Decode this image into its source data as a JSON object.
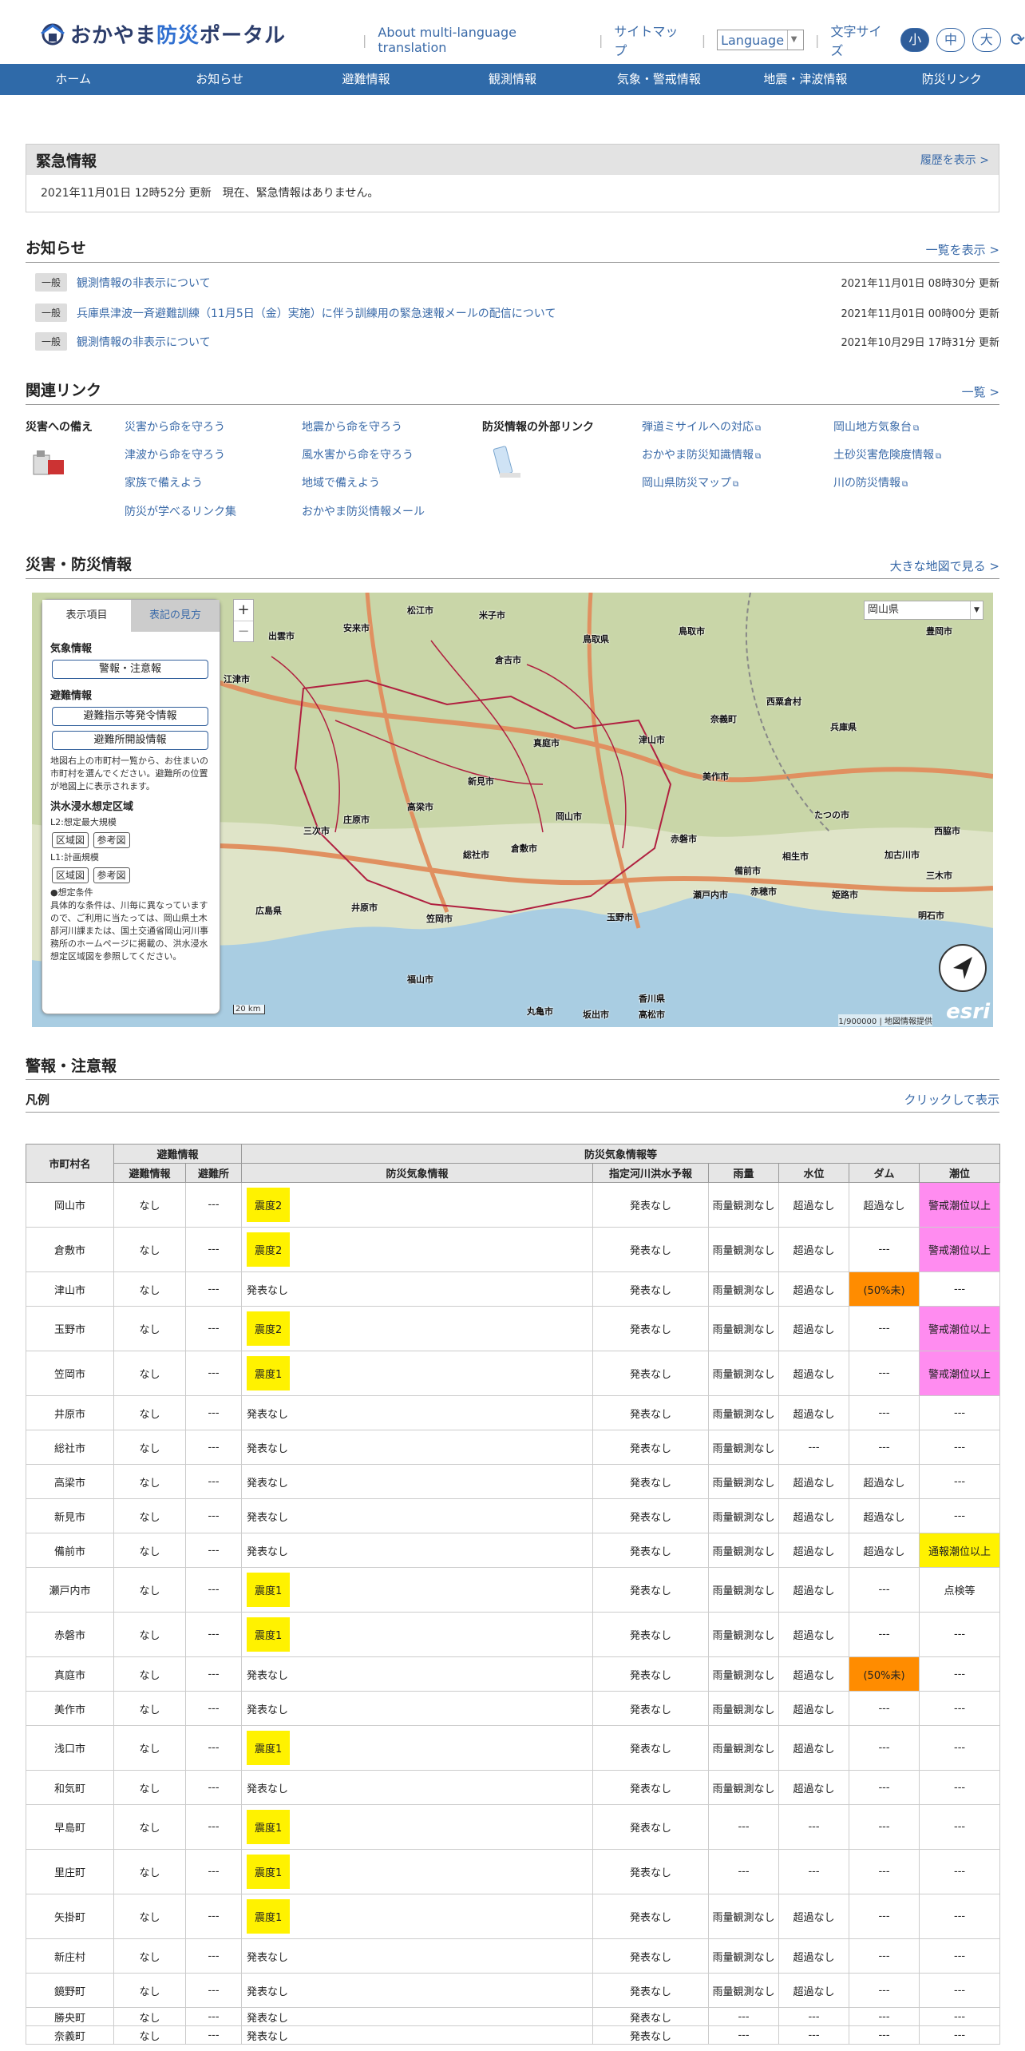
{
  "header": {
    "logo_a": "おかやま",
    "logo_b": "防災",
    "logo_c": "ポータル",
    "links": [
      "About multi-language translation",
      "サイトマップ"
    ],
    "language": "Language",
    "font_size_label": "文字サイズ",
    "font_sizes": [
      "小",
      "中",
      "大"
    ]
  },
  "nav": [
    "ホーム",
    "お知らせ",
    "避難情報",
    "観測情報",
    "気象・警戒情報",
    "地震・津波情報",
    "防災リンク"
  ],
  "emergency": {
    "title": "緊急情報",
    "history_link": "履歴を表示 >",
    "message": "2021年11月01日 12時52分 更新　現在、緊急情報はありません。"
  },
  "notices": {
    "title": "お知らせ",
    "more": "一覧を表示 >",
    "items": [
      {
        "tag": "一般",
        "text": "観測情報の非表示について",
        "date": "2021年11月01日 08時30分 更新"
      },
      {
        "tag": "一般",
        "text": "兵庫県津波一斉避難訓練（11月5日（金）実施）に伴う訓練用の緊急速報メールの配信について",
        "date": "2021年11月01日 00時00分 更新"
      },
      {
        "tag": "一般",
        "text": "観測情報の非表示について",
        "date": "2021年10月29日 17時31分 更新"
      }
    ]
  },
  "related": {
    "title": "関連リンク",
    "more": "一覧 >",
    "group1": "災害への備え",
    "group2": "防災情報の外部リンク",
    "links1": [
      "災害から命を守ろう",
      "地震から命を守ろう",
      "津波から命を守ろう",
      "風水害から命を守ろう",
      "家族で備えよう",
      "地域で備えよう",
      "防災が学べるリンク集",
      "おかやま防災情報メール"
    ],
    "links2": [
      "弾道ミサイルへの対応",
      "岡山地方気象台",
      "おかやま防災知識情報",
      "土砂災害危険度情報",
      "岡山県防災マップ",
      "川の防災情報"
    ]
  },
  "map": {
    "title": "災害・防災情報",
    "more": "大きな地図で見る >",
    "tab_on": "表示項目",
    "tab_off": "表記の見方",
    "weather_label": "気象情報",
    "weather_btn": "警報・注意報",
    "evac_label": "避難情報",
    "evac_btn1": "避難指示等発令情報",
    "evac_btn2": "避難所開設情報",
    "evac_note": "地図右上の市町村一覧から、お住まいの市町村を選んでください。避難所の位置が地図上に表示されます。",
    "flood_label": "洪水浸水想定区域",
    "l2": "L2:想定最大規模",
    "l1": "L1:計画規模",
    "btn_area": "区域図",
    "btn_ref": "参考図",
    "cond_title": "●想定条件",
    "cond_text": "具体的な条件は、川毎に異なっていますので、ご利用に当たっては、岡山県土木部河川課または、国土交通省岡山河川事務所のホームページに掲載の、洪水浸水想定区域図を参照してください。",
    "select": "岡山県",
    "scale": "20 km",
    "attribution": "1/900000 | 地図情報提供",
    "esri": "esri",
    "places": [
      "鳥取県",
      "兵庫県",
      "岡山市",
      "倉敷市",
      "津山市",
      "広島県",
      "新見市",
      "真庭市",
      "高梁市",
      "赤磐市",
      "美作市",
      "備前市",
      "総社市",
      "笠岡市",
      "井原市",
      "玉野市",
      "瀬戸内市",
      "香川県",
      "姫路市",
      "加古川市",
      "たつの市",
      "相生市",
      "赤穂市",
      "倉吉市",
      "鳥取市",
      "出雲市",
      "米子市",
      "庄原市",
      "三次市",
      "福山市",
      "豊岡市",
      "西脇市",
      "三木市",
      "明石市",
      "高松市",
      "坂出市",
      "丸亀市",
      "江津市",
      "安来市",
      "松江市",
      "奈義町",
      "西粟倉村"
    ]
  },
  "warnings": {
    "title": "警報・注意報",
    "legend": "凡例",
    "legend_link": "クリックして表示",
    "header_group1": "避難情報",
    "header_group2": "防災気象情報等",
    "cols": [
      "市町村名",
      "避難情報",
      "避難所",
      "防災気象情報",
      "指定河川洪水予報",
      "雨量",
      "水位",
      "ダム",
      "潮位"
    ],
    "rows": [
      [
        "岡山市",
        "なし",
        "---",
        "震度2",
        "発表なし",
        "雨量観測なし",
        "超過なし",
        "超過なし",
        "警戒潮位以上"
      ],
      [
        "倉敷市",
        "なし",
        "---",
        "震度2",
        "発表なし",
        "雨量観測なし",
        "超過なし",
        "---",
        "警戒潮位以上"
      ],
      [
        "津山市",
        "なし",
        "---",
        "発表なし",
        "発表なし",
        "雨量観測なし",
        "超過なし",
        "(50%未)",
        "---"
      ],
      [
        "玉野市",
        "なし",
        "---",
        "震度2",
        "発表なし",
        "雨量観測なし",
        "超過なし",
        "---",
        "警戒潮位以上"
      ],
      [
        "笠岡市",
        "なし",
        "---",
        "震度1",
        "発表なし",
        "雨量観測なし",
        "超過なし",
        "---",
        "警戒潮位以上"
      ],
      [
        "井原市",
        "なし",
        "---",
        "発表なし",
        "発表なし",
        "雨量観測なし",
        "超過なし",
        "---",
        "---"
      ],
      [
        "総社市",
        "なし",
        "---",
        "発表なし",
        "発表なし",
        "雨量観測なし",
        "---",
        "---",
        "---"
      ],
      [
        "高梁市",
        "なし",
        "---",
        "発表なし",
        "発表なし",
        "雨量観測なし",
        "超過なし",
        "超過なし",
        "---"
      ],
      [
        "新見市",
        "なし",
        "---",
        "発表なし",
        "発表なし",
        "雨量観測なし",
        "超過なし",
        "超過なし",
        "---"
      ],
      [
        "備前市",
        "なし",
        "---",
        "発表なし",
        "発表なし",
        "雨量観測なし",
        "超過なし",
        "超過なし",
        "通報潮位以上"
      ],
      [
        "瀬戸内市",
        "なし",
        "---",
        "震度1",
        "発表なし",
        "雨量観測なし",
        "超過なし",
        "---",
        "点検等"
      ],
      [
        "赤磐市",
        "なし",
        "---",
        "震度1",
        "発表なし",
        "雨量観測なし",
        "超過なし",
        "---",
        "---"
      ],
      [
        "真庭市",
        "なし",
        "---",
        "発表なし",
        "発表なし",
        "雨量観測なし",
        "超過なし",
        "(50%未)",
        "---"
      ],
      [
        "美作市",
        "なし",
        "---",
        "発表なし",
        "発表なし",
        "雨量観測なし",
        "超過なし",
        "---",
        "---"
      ],
      [
        "浅口市",
        "なし",
        "---",
        "震度1",
        "発表なし",
        "雨量観測なし",
        "超過なし",
        "---",
        "---"
      ],
      [
        "和気町",
        "なし",
        "---",
        "発表なし",
        "発表なし",
        "雨量観測なし",
        "超過なし",
        "---",
        "---"
      ],
      [
        "早島町",
        "なし",
        "---",
        "震度1",
        "発表なし",
        "---",
        "---",
        "---",
        "---"
      ],
      [
        "里庄町",
        "なし",
        "---",
        "震度1",
        "発表なし",
        "---",
        "---",
        "---",
        "---"
      ],
      [
        "矢掛町",
        "なし",
        "---",
        "震度1",
        "発表なし",
        "雨量観測なし",
        "超過なし",
        "---",
        "---"
      ],
      [
        "新庄村",
        "なし",
        "---",
        "発表なし",
        "発表なし",
        "雨量観測なし",
        "超過なし",
        "---",
        "---"
      ],
      [
        "鏡野町",
        "なし",
        "---",
        "発表なし",
        "発表なし",
        "雨量観測なし",
        "超過なし",
        "---",
        "---"
      ],
      [
        "勝央町",
        "なし",
        "---",
        "発表なし",
        "発表なし",
        "---",
        "---",
        "---",
        "---"
      ],
      [
        "奈義町",
        "なし",
        "---",
        "発表なし",
        "発表なし",
        "---",
        "---",
        "---",
        "---"
      ]
    ]
  },
  "colors": {
    "nav": "#2f6aa9",
    "badge_yellow": "#fff200",
    "orange": "#ff8c00",
    "pink": "#ff8cf0"
  }
}
